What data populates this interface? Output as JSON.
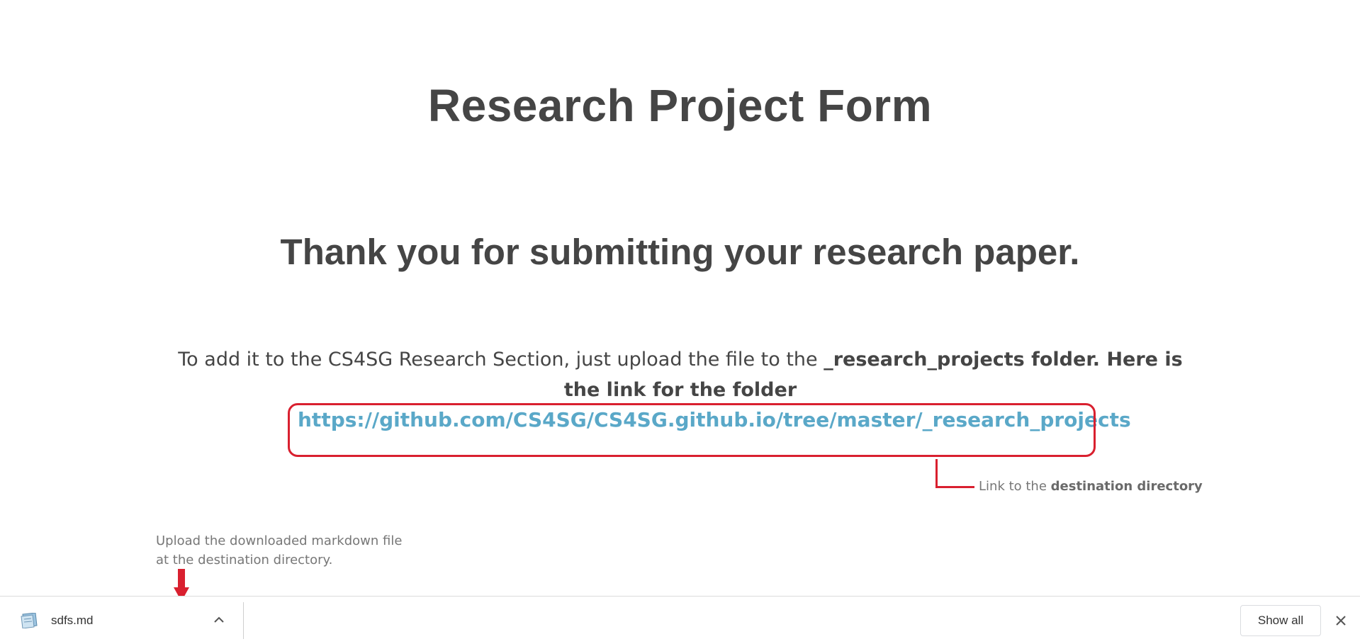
{
  "page": {
    "title": "Research Project Form",
    "thank_you": "Thank you for submitting your research paper.",
    "instructions_intro": "To add it to the CS4SG Research Section, just upload the file to the ",
    "instructions_bold": "_research_projects folder. Here is the link for the folder",
    "folder_link": "https://github.com/CS4SG/CS4SG.github.io/tree/master/_research_projects"
  },
  "annotations": {
    "link_callout_prefix": "Link to the ",
    "link_callout_bold": "destination directory",
    "upload_note": "Upload the downloaded markdown file at the destination directory.",
    "accent_color": "#d9202f"
  },
  "download_bar": {
    "file_name": "sdfs.md",
    "file_icon": "markdown-file-icon",
    "show_all_label": "Show all",
    "close_icon": "close-icon"
  },
  "colors": {
    "text": "#454545",
    "link": "#5aa8c8",
    "annotation_red": "#d9202f"
  }
}
